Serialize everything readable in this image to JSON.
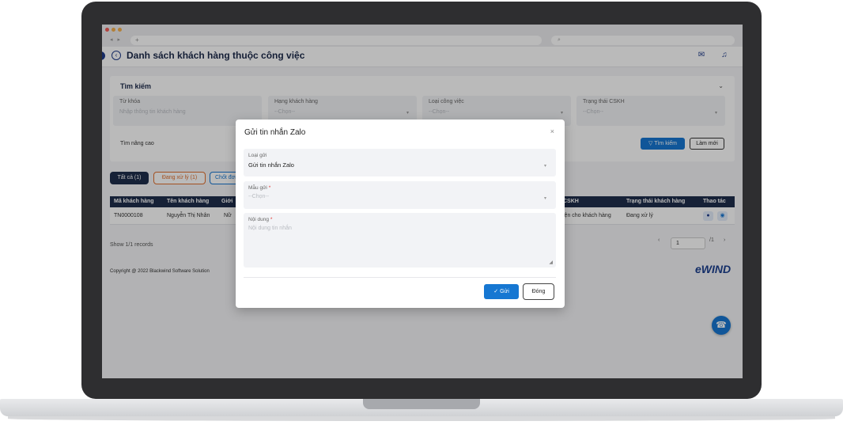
{
  "browser": {
    "url": "+",
    "search": "⌕",
    "nav": "◂ ▸"
  },
  "header": {
    "title": "Danh sách khách hàng thuộc công việc"
  },
  "filter": {
    "title": "Tìm kiếm",
    "fields": [
      {
        "label": "Từ khóa",
        "placeholder": "Nhập thông tin khách hàng"
      },
      {
        "label": "Hạng khách hàng",
        "placeholder": "--Chọn--"
      },
      {
        "label": "Loại công việc",
        "placeholder": "--Chọn--"
      },
      {
        "label": "Trạng thái CSKH",
        "placeholder": "--Chọn--"
      }
    ],
    "advanced": "Tìm nâng cao",
    "search_button": "Tìm kiếm",
    "reset_button": "Làm mới"
  },
  "tabs": {
    "all": "Tất cả (1)",
    "pending": "Đang xử lý (1)",
    "closed": "Chốt đơn"
  },
  "table": {
    "headers": [
      "Mã khách hàng",
      "Tên khách hàng",
      "Giới",
      "CSKH",
      "Trạng thái khách hàng",
      "Thao tác"
    ],
    "row": {
      "code": "TN0000108",
      "name": "Nguyễn Thị Nhân",
      "gender": "Nữ",
      "cskh": "iện cho khách hàng",
      "status": "Đang xử lý"
    }
  },
  "footer": {
    "records": "Show 1/1 records",
    "page_value": "1",
    "page_total": "/1",
    "copyright": "Copyright @ 2022 Blackwind Software Solution",
    "brand": "eWIND"
  },
  "modal": {
    "title": "Gửi tin nhắn Zalo",
    "send_type_label": "Loại gửi",
    "send_type_value": "Gửi tin nhắn Zalo",
    "template_label": "Mẫu gửi",
    "template_placeholder": "--Chọn--",
    "content_label": "Nội dung",
    "content_placeholder": "Nội dung tin nhắn",
    "send_button": "Gửi",
    "close_button": "Đóng"
  },
  "colors": {
    "primary": "#1677d2",
    "navy": "#1f2e4c",
    "pending": "#e06e2d",
    "required": "#e0322d"
  }
}
